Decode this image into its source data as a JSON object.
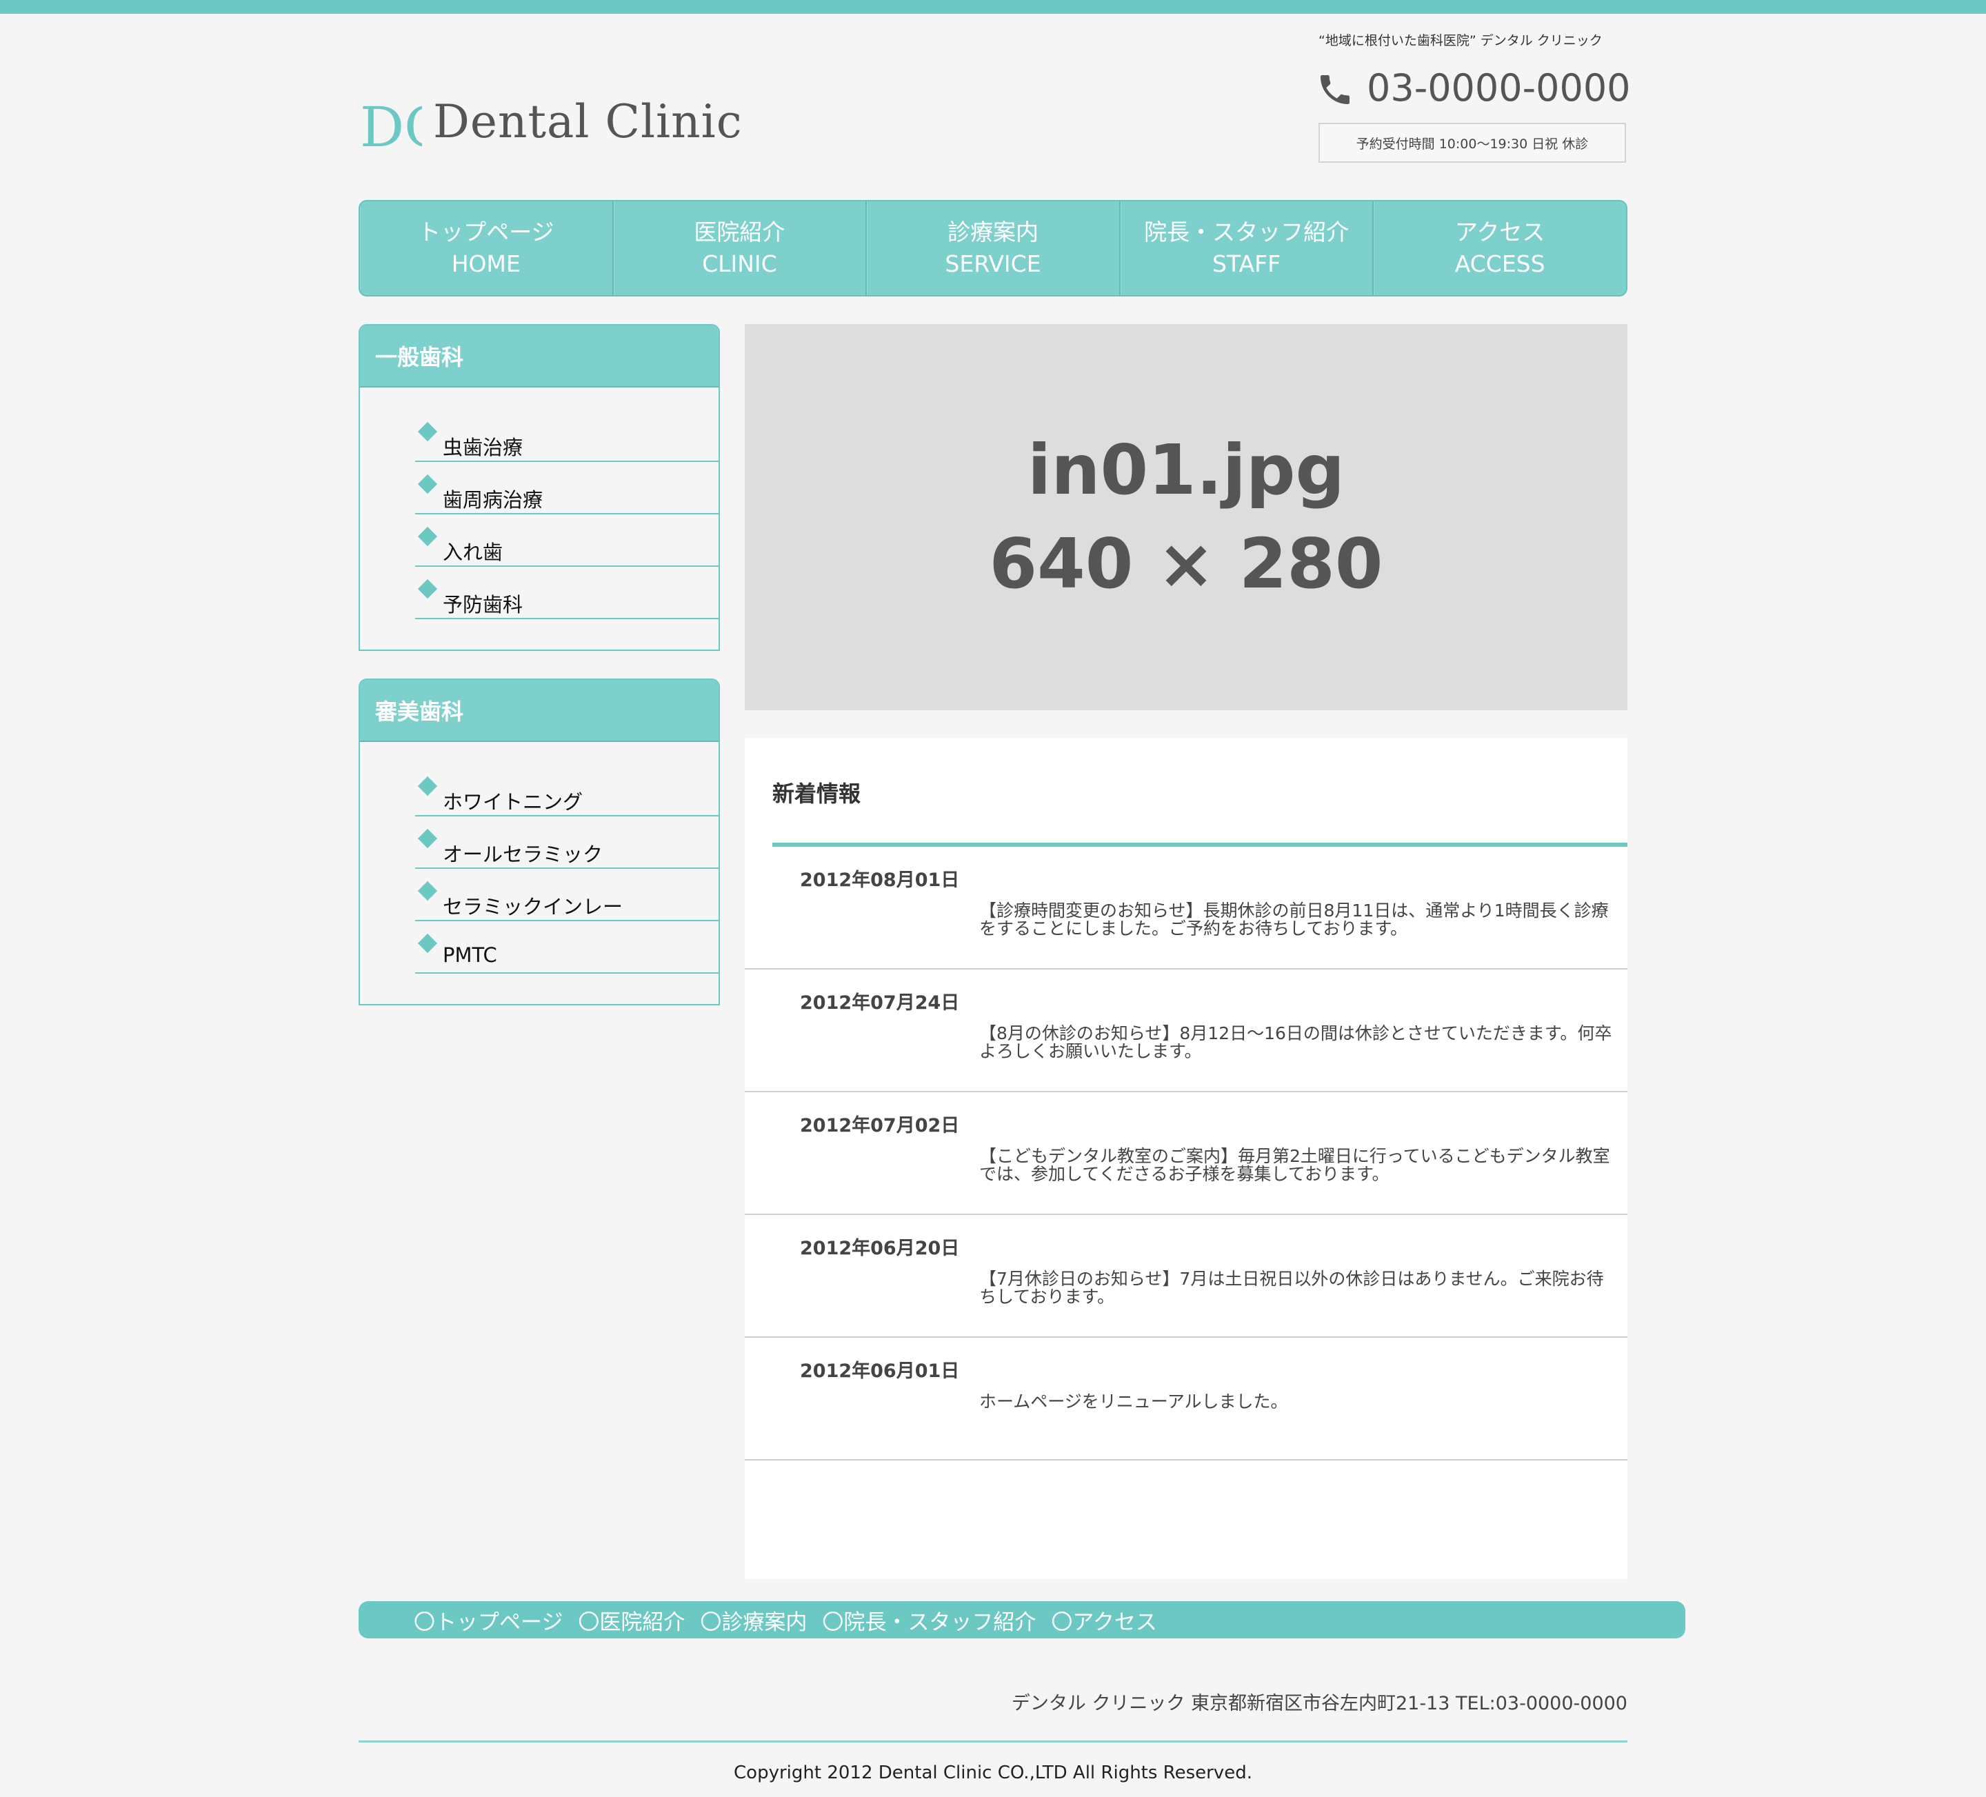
{
  "header": {
    "tagline": "“地域に根付いた歯科医院” デンタル クリニック",
    "logo_mark": "DC",
    "logo_text": "Dental Clinic",
    "phone": "03-0000-0000",
    "hours": "予約受付時間 10:00〜19:30 日祝 休診"
  },
  "nav": [
    {
      "jp": "トップページ",
      "en": "HOME"
    },
    {
      "jp": "医院紹介",
      "en": "CLINIC"
    },
    {
      "jp": "診療案内",
      "en": "SERVICE"
    },
    {
      "jp": "院長・スタッフ紹介",
      "en": "STAFF"
    },
    {
      "jp": "アクセス",
      "en": "ACCESS"
    }
  ],
  "sidebar": {
    "general": {
      "title": "一般歯科",
      "items": [
        "虫歯治療",
        "歯周病治療",
        "入れ歯",
        "予防歯科"
      ]
    },
    "cosmetic": {
      "title": "審美歯科",
      "items": [
        "ホワイトニング",
        "オールセラミック",
        "セラミックインレー",
        "PMTC"
      ]
    }
  },
  "hero": {
    "filename": "in01.jpg",
    "size": "640 × 280"
  },
  "news": {
    "title": "新着情報",
    "items": [
      {
        "date": "2012年08月01日",
        "text": "【診療時間変更のお知らせ】長期休診の前日8月11日は、通常より1時間長く診療をすることにしました。ご予約をお待ちしております。"
      },
      {
        "date": "2012年07月24日",
        "text": "【8月の休診のお知らせ】8月12日〜16日の間は休診とさせていただきます。何卒よろしくお願いいたします。"
      },
      {
        "date": "2012年07月02日",
        "text": "【こどもデンタル教室のご案内】毎月第2土曜日に行っているこどもデンタル教室では、参加してくださるお子様を募集しております。"
      },
      {
        "date": "2012年06月20日",
        "text": "【7月休診日のお知らせ】7月は土日祝日以外の休診日はありません。ご来院お待ちしております。"
      },
      {
        "date": "2012年06月01日",
        "text": "ホームページをリニューアルしました。"
      }
    ]
  },
  "footer": {
    "links": [
      "〇トップページ",
      "〇医院紹介",
      "〇診療案内",
      "〇院長・スタッフ紹介",
      "〇アクセス"
    ],
    "address": "デンタル クリニック 東京都新宿区市谷左内町21-13 TEL:03-0000-0000",
    "copyright": "Copyright 2012 Dental Clinic CO.,LTD All Rights Reserved."
  },
  "colors": {
    "accent": "#6cc8c3",
    "nav_bg": "#7dd0cc",
    "page_bg": "#f5f5f5"
  }
}
